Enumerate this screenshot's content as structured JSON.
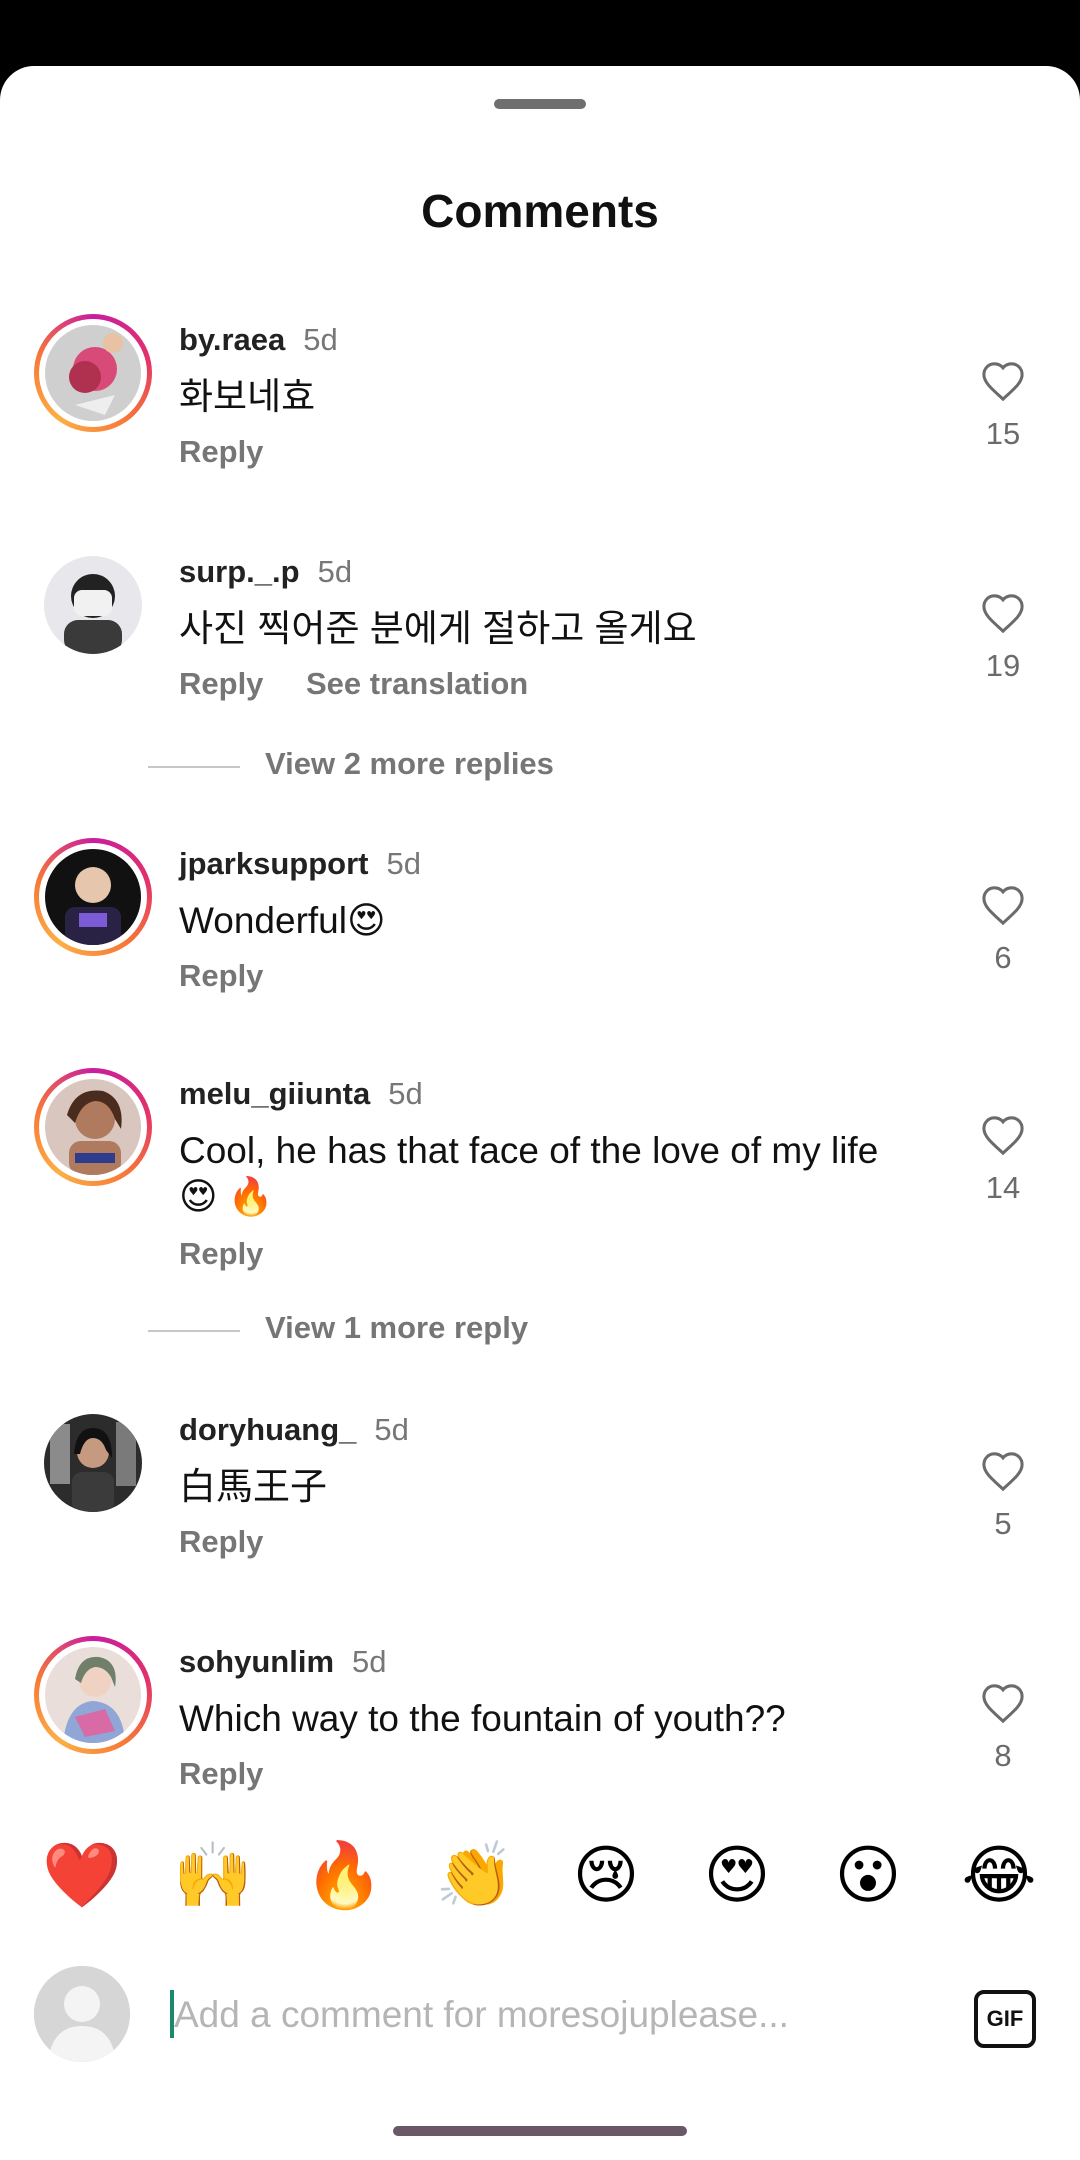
{
  "sheet": {
    "title": "Comments"
  },
  "comments": [
    {
      "username": "by.raea",
      "time": "5d",
      "text": "화보네효",
      "reply": "Reply",
      "likes": "15",
      "story_ring": true
    },
    {
      "username": "surp._.p",
      "time": "5d",
      "text": "사진 찍어준 분에게 절하고 올게요",
      "reply": "Reply",
      "see_translation": "See translation",
      "likes": "19",
      "story_ring": false
    },
    {
      "username": "jparksupport",
      "time": "5d",
      "text": "Wonderful😍",
      "reply": "Reply",
      "likes": "6",
      "story_ring": true
    },
    {
      "username": "melu_giiunta",
      "time": "5d",
      "text": "Cool, he has that face of the love of my life 😍 🔥",
      "reply": "Reply",
      "likes": "14",
      "story_ring": true
    },
    {
      "username": "doryhuang_",
      "time": "5d",
      "text": "白馬王子",
      "reply": "Reply",
      "likes": "5",
      "story_ring": false
    },
    {
      "username": "sohyunlim",
      "time": "5d",
      "text": "Which way to the fountain of youth??",
      "reply": "Reply",
      "likes": "8",
      "story_ring": true
    }
  ],
  "more_replies": [
    {
      "label": "View 2 more replies"
    },
    {
      "label": "View 1 more reply"
    }
  ],
  "reactions": [
    "❤️",
    "🙌",
    "🔥",
    "👏",
    "😢",
    "😍",
    "😮",
    "😂"
  ],
  "composer": {
    "placeholder": "Add a comment for moresojuplease...",
    "gif_label": "GIF"
  },
  "icons": {
    "like": "heart-outline-icon",
    "gif": "gif-icon",
    "avatar_placeholder": "user-silhouette-icon"
  },
  "colors": {
    "ring_start": "#c81e9f",
    "ring_end": "#fcaf45",
    "caret": "#1a8a6c"
  }
}
